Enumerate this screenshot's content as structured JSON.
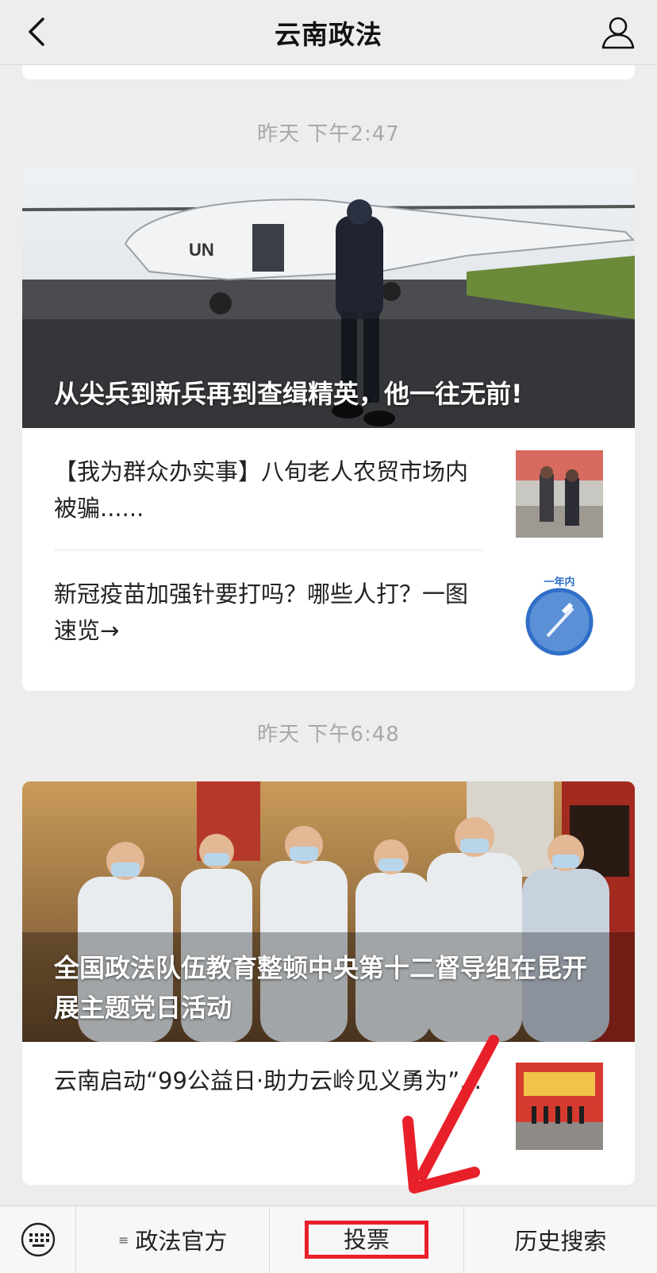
{
  "header": {
    "title": "云南政法",
    "back_icon": "chevron-left-icon",
    "profile_icon": "user-icon"
  },
  "groups": [
    {
      "timestamp": "昨天 下午2:47",
      "hero_title": "从尖兵到新兵再到查缉精英，他一往无前!",
      "items": [
        {
          "title": "【我为群众办实事】八旬老人农贸市场内被骗......"
        },
        {
          "title": "新冠疫苗加强针要打吗？哪些人打？一图速览→",
          "thumb_label": "一年内"
        }
      ]
    },
    {
      "timestamp": "昨天 下午6:48",
      "hero_title": "全国政法队伍教育整顿中央第十二督导组在昆开展主题党日活动",
      "items": [
        {
          "title": "云南启动“99公益日·助力云岭见义勇为”..."
        }
      ]
    }
  ],
  "bottom_menu": {
    "keyboard_icon": "keyboard-icon",
    "items": [
      {
        "label": "政法官方",
        "icon": "menu-lines-icon"
      },
      {
        "label": "投票"
      },
      {
        "label": "历史搜索"
      }
    ]
  },
  "colors": {
    "annotation_red": "#e8202a",
    "background": "#ededed"
  }
}
